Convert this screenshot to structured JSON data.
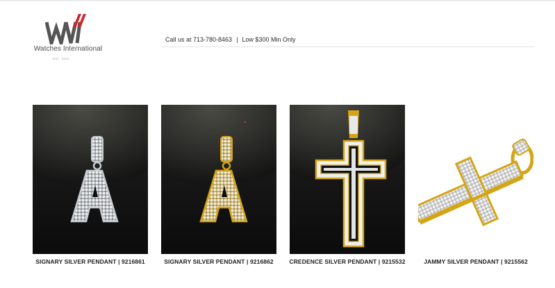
{
  "header": {
    "brand_name": "Watches International",
    "brand_est": "EST. 2002",
    "phone_text": "Call us at 713-780-8463",
    "separator": "|",
    "min_order_text": "Low $300 Min Only"
  },
  "products": [
    {
      "title": "SIGNARY SILVER PENDANT | 9216861"
    },
    {
      "title": "SIGNARY SILVER PENDANT | 9216862"
    },
    {
      "title": "CREDENCE SILVER PENDANT | 9215532"
    },
    {
      "title": "JAMMY SILVER PENDANT | 9215562"
    }
  ],
  "colors": {
    "brand_red": "#d0232a",
    "brand_gray": "#555555",
    "gold": "#d4a514"
  }
}
